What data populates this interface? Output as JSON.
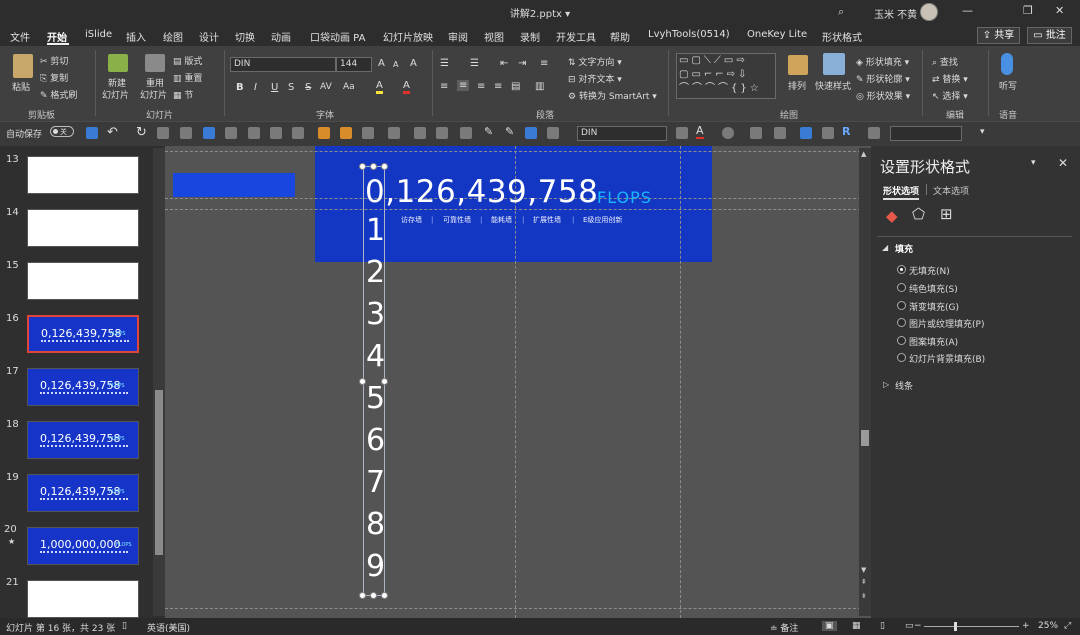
{
  "titlebar": {
    "title": "讲解2.pptx",
    "title_caret": "▾",
    "search_icon": "search-icon",
    "user_name": "玉米 不黄",
    "minimize": "—",
    "restore": "❐",
    "close": "✕"
  },
  "tabs": [
    "文件",
    "开始",
    "iSlide",
    "插入",
    "绘图",
    "设计",
    "切换",
    "动画",
    "口袋动画 PA",
    "幻灯片放映",
    "审阅",
    "视图",
    "录制",
    "开发工具",
    "帮助",
    "LvyhTools(0514)",
    "OneKey Lite",
    "形状格式"
  ],
  "active_tab": "开始",
  "share_label": "共享",
  "comment_label": "批注",
  "ribbon": {
    "clipboard": {
      "paste": "粘贴",
      "cut": "剪切",
      "copy": "复制",
      "format_painter": "格式刷",
      "group": "剪贴板"
    },
    "slides": {
      "new_slide": "新建",
      "new_slide2": "幻灯片",
      "reuse": "重用",
      "reuse2": "幻灯片",
      "layout": "版式",
      "reset": "重置",
      "section": "节",
      "group": "幻灯片"
    },
    "font": {
      "name": "DIN",
      "size": "144",
      "bold": "B",
      "italic": "I",
      "underline": "U",
      "strike": "S",
      "shadow": "S",
      "spacing": "AV",
      "case": "Aa",
      "color_a": "A",
      "highlight": "A",
      "grow": "A",
      "shrink": "A",
      "clear": "A",
      "group": "字体"
    },
    "paragraph": {
      "text_dir": "文字方向",
      "align_text": "对齐文本",
      "smartart": "转换为 SmartArt",
      "group": "段落"
    },
    "drawing": {
      "arrange": "排列",
      "quick_styles": "快速样式",
      "shape_fill": "形状填充",
      "shape_outline": "形状轮廓",
      "shape_effects": "形状效果",
      "group": "绘图"
    },
    "editing": {
      "find": "查找",
      "replace": "替换",
      "select": "选择",
      "group": "编辑"
    },
    "voice": {
      "dictate": "听写",
      "group": "语音"
    }
  },
  "qat": {
    "autosave_label": "自动保存",
    "autosave_state": "关",
    "font_name": "DIN"
  },
  "slides": [
    {
      "num": "13",
      "kind": "white"
    },
    {
      "num": "14",
      "kind": "white"
    },
    {
      "num": "15",
      "kind": "white"
    },
    {
      "num": "16",
      "kind": "blue",
      "text": "0,126,439,758",
      "flops": "FLOPS",
      "selected": true
    },
    {
      "num": "17",
      "kind": "blue",
      "text": "0,126,439,758",
      "flops": "FLOPS"
    },
    {
      "num": "18",
      "kind": "blue",
      "text": "0,126,439,758",
      "flops": "FLOPS"
    },
    {
      "num": "19",
      "kind": "blue",
      "text": "0,126,439,758",
      "flops": "FLOPS"
    },
    {
      "num": "20",
      "kind": "blue",
      "text": "1,000,000,000",
      "flops": "FLOPS",
      "star": "★"
    },
    {
      "num": "21",
      "kind": "white"
    }
  ],
  "canvas": {
    "big_number": "0,126,439,758",
    "unit": "FLOPS",
    "subtags": [
      "访存墙",
      "可靠性墙",
      "能耗墙",
      "扩展性墙",
      "E级应用创新"
    ],
    "subtag_sep": "|",
    "digits": [
      "1",
      "2",
      "3",
      "4",
      "5",
      "6",
      "7",
      "8",
      "9"
    ]
  },
  "pane": {
    "title": "设置形状格式",
    "pin": "▾",
    "close": "✕",
    "tab_shape": "形状选项",
    "tab_text": "文本选项",
    "fill_header": "填充",
    "fill_caret": "◢",
    "line_header": "线条",
    "line_caret": "▷",
    "options": [
      "无填充(N)",
      "纯色填充(S)",
      "渐变填充(G)",
      "图片或纹理填充(P)",
      "图案填充(A)",
      "幻灯片背景填充(B)"
    ],
    "selected_option": "无填充(N)"
  },
  "status": {
    "slide_info": "幻灯片 第 16 张，共 23 张",
    "language": "英语(美国)",
    "notes": "备注",
    "zoom_minus": "−",
    "zoom_plus": "+",
    "zoom": "25%",
    "zoom_level": 0.25
  },
  "colors": {
    "slide_blue": "#1337c2",
    "flops_cyan": "#19b5ff",
    "selection_red": "#e0453a"
  }
}
